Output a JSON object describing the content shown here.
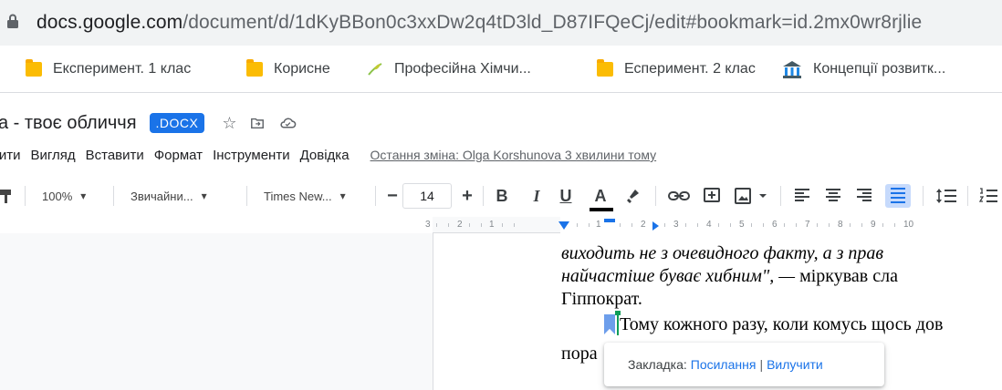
{
  "address_bar": {
    "domain": "docs.google.com",
    "path": "/document/d/1dKyBBon0c3xxDw2q4tD3ld_D87IFQeCj/edit#bookmark=id.2mx0wr8rjlie"
  },
  "bookmarks": [
    {
      "label": "Експеримент. 1 клас",
      "icon": "folder-icon"
    },
    {
      "label": "Корисне",
      "icon": "folder-icon"
    },
    {
      "label": "Професійна Хімчи...",
      "icon": "leaf-icon"
    },
    {
      "label": "Есперимент. 2 клас",
      "icon": "folder-icon"
    },
    {
      "label": "Концепції розвитк...",
      "icon": "building-icon"
    }
  ],
  "document": {
    "title": "а - твоє обличчя",
    "badge": ".DOCX"
  },
  "menu": {
    "items": [
      "чити",
      "Вигляд",
      "Вставити",
      "Формат",
      "Інструменти",
      "Довідка"
    ],
    "last_edit": "Остання зміна: Olga Korshunova 3 хвилини тому"
  },
  "toolbar": {
    "zoom": "100%",
    "style": "Звичайни...",
    "font": "Times New...",
    "minus": "−",
    "size": "14",
    "plus": "+",
    "bold": "B",
    "italic": "I",
    "underline": "U",
    "textcolor": "A"
  },
  "ruler": {
    "numbers": [
      "3",
      "2",
      "1",
      "1",
      "2",
      "3",
      "4",
      "5",
      "6",
      "7",
      "8",
      "9",
      "10"
    ]
  },
  "body_text": {
    "line1_a": "виходить не з очевидного факту, а з прав",
    "line2_a": "найчастіше буває хибним\", — ",
    "line2_b": "міркував сла",
    "line3": "Гіппократ.",
    "line4": "Тому кожного разу, коли комусь щось дов",
    "line5": "пора"
  },
  "bookmark_popup": {
    "prefix": "Закладка: ",
    "link": "Посилання",
    "separator": "|",
    "remove": "Вилучити"
  },
  "colors": {
    "accent": "#1a73e8",
    "bookmark": "#6d9eeb",
    "cursor": "#0f9d58"
  }
}
